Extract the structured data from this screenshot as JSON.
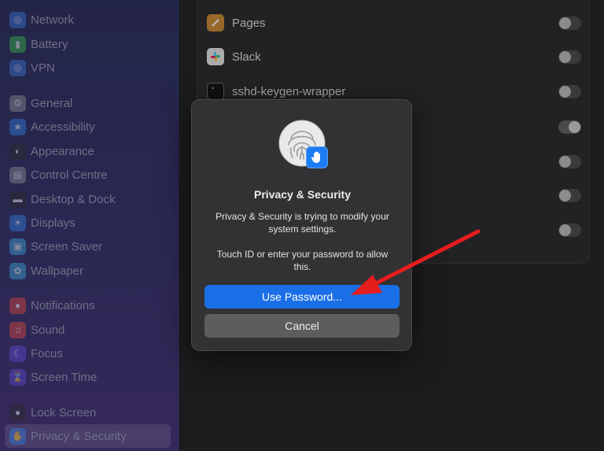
{
  "sidebar": {
    "items": [
      {
        "label": "Network",
        "icon": "globe-icon",
        "color": "#3a73d8"
      },
      {
        "label": "Battery",
        "icon": "battery-icon",
        "color": "#3bb54a"
      },
      {
        "label": "VPN",
        "icon": "vpn-icon",
        "color": "#3a73d8"
      },
      {
        "label": "General",
        "icon": "gear-icon",
        "color": "#8e8e93"
      },
      {
        "label": "Accessibility",
        "icon": "accessibility-icon",
        "color": "#2f7de0"
      },
      {
        "label": "Appearance",
        "icon": "appearance-icon",
        "color": "#2b2b2b"
      },
      {
        "label": "Control Centre",
        "icon": "control-centre-icon",
        "color": "#8e8e93"
      },
      {
        "label": "Desktop & Dock",
        "icon": "dock-icon",
        "color": "#2b2b2b"
      },
      {
        "label": "Displays",
        "icon": "displays-icon",
        "color": "#2f7de0"
      },
      {
        "label": "Screen Saver",
        "icon": "screen-saver-icon",
        "color": "#3aa6d8"
      },
      {
        "label": "Wallpaper",
        "icon": "wallpaper-icon",
        "color": "#3aa6d8"
      },
      {
        "label": "Notifications",
        "icon": "notifications-icon",
        "color": "#e0453a"
      },
      {
        "label": "Sound",
        "icon": "sound-icon",
        "color": "#e0453a"
      },
      {
        "label": "Focus",
        "icon": "focus-moon-icon",
        "color": "#5b4bd6"
      },
      {
        "label": "Screen Time",
        "icon": "hourglass-icon",
        "color": "#5b4bd6"
      },
      {
        "label": "Lock Screen",
        "icon": "lock-icon",
        "color": "#2b2b2b"
      },
      {
        "label": "Privacy & Security",
        "icon": "hand-icon",
        "color": "#2f7de0",
        "selected": true
      }
    ]
  },
  "apps": [
    {
      "name": "Pages",
      "icon": "pages-icon",
      "on": false
    },
    {
      "name": "Slack",
      "icon": "slack-icon",
      "on": false
    },
    {
      "name": "sshd-keygen-wrapper",
      "icon": "terminal-icon",
      "on": false
    },
    {
      "name": "",
      "on": true
    },
    {
      "name": "",
      "on": false
    },
    {
      "name": "",
      "on": false
    },
    {
      "name": "",
      "on": false
    }
  ],
  "dialog": {
    "title": "Privacy & Security",
    "message": "Privacy & Security is trying to modify your system settings.",
    "instruction": "Touch ID or enter your password to allow this.",
    "primary_button": "Use Password...",
    "secondary_button": "Cancel"
  },
  "colors": {
    "accent": "#1a6fe6",
    "annotation_arrow": "#e51d1d"
  }
}
